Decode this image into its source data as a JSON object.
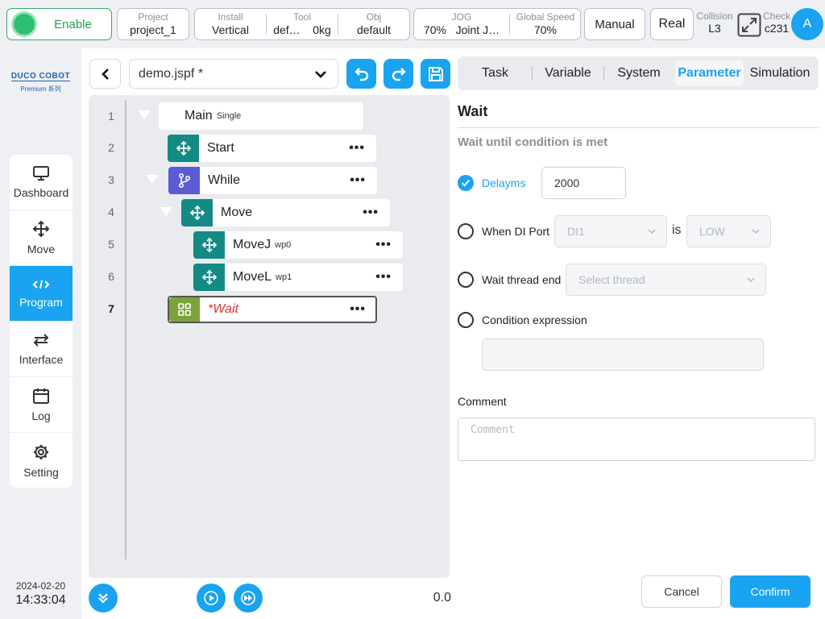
{
  "topbar": {
    "enable_label": "Enable",
    "project": {
      "label": "Project",
      "value": "project_1"
    },
    "install": {
      "label": "Install",
      "value": "Vertical"
    },
    "tool": {
      "label": "Tool",
      "value": "def…",
      "extra": "0kg"
    },
    "obj": {
      "label": "Obj",
      "value": "default"
    },
    "jog": {
      "label": "JOG",
      "value": "70%",
      "mode": "Joint J…"
    },
    "global_speed": {
      "label": "Global Speed",
      "value": "70%"
    },
    "mode_label": "Manual",
    "real_label": "Real",
    "collision": {
      "label": "Collision",
      "value": "L3"
    },
    "check": {
      "label": "Check",
      "value": "c231"
    },
    "avatar_letter": "A"
  },
  "logo": {
    "brand": "DUCO COBOT",
    "series": "Premium 系列"
  },
  "sidebar": {
    "items": [
      {
        "label": "Dashboard",
        "icon": "monitor-icon"
      },
      {
        "label": "Move",
        "icon": "move-icon"
      },
      {
        "label": "Program",
        "icon": "code-icon"
      },
      {
        "label": "Interface",
        "icon": "swap-icon"
      },
      {
        "label": "Log",
        "icon": "calendar-icon"
      },
      {
        "label": "Setting",
        "icon": "gear-icon"
      }
    ],
    "active": "Program",
    "date": "2024-02-20",
    "time": "14:33:04"
  },
  "editor": {
    "file": "demo.jspf *",
    "lines": [
      "1",
      "2",
      "3",
      "4",
      "5",
      "6",
      "7"
    ],
    "nodes": {
      "main": {
        "name": "Main",
        "sub": "Single"
      },
      "start": {
        "name": "Start"
      },
      "while": {
        "name": "While"
      },
      "move": {
        "name": "Move"
      },
      "movej": {
        "name": "MoveJ",
        "sub": "wp0"
      },
      "movel": {
        "name": "MoveL",
        "sub": "wp1"
      },
      "wait": {
        "name": "*Wait"
      }
    },
    "more_glyph": "•••",
    "counter": "0.0"
  },
  "panel": {
    "tabs": [
      "Task",
      "Variable",
      "System",
      "Parameter",
      "Simulation"
    ],
    "active_tab": "Parameter",
    "title": "Wait",
    "description": "Wait until condition is met",
    "delay": {
      "label": "Delayms",
      "value": "2000",
      "checked": true
    },
    "di_port": {
      "label": "When DI Port",
      "port": "DI1",
      "is": "is",
      "level": "LOW"
    },
    "thread": {
      "label": "Wait thread end",
      "placeholder": "Select thread"
    },
    "condition": {
      "label": "Condition expression",
      "value": ""
    },
    "comment": {
      "label": "Comment",
      "placeholder": "Comment"
    },
    "cancel": "Cancel",
    "confirm": "Confirm"
  },
  "colors": {
    "accent": "#1aa3f0",
    "enable": "#2fbf71",
    "teal": "#138a84",
    "purple": "#5b5bd6",
    "olive": "#7da23b"
  }
}
